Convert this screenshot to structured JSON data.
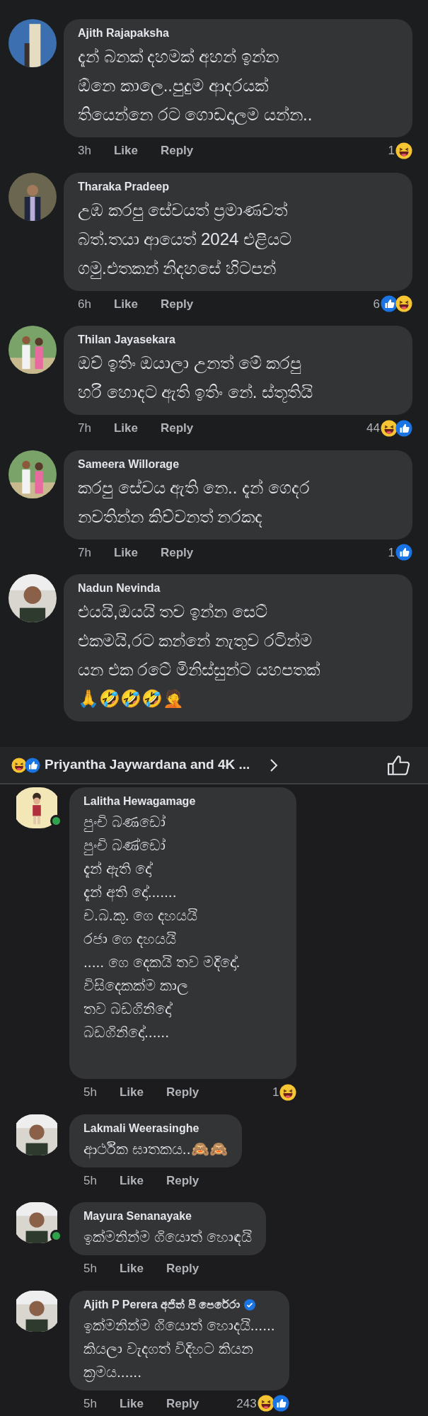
{
  "sections": [
    {
      "kind": "wide",
      "comments": [
        {
          "author": "Ajith Rajapaksha",
          "online": false,
          "verified": false,
          "text": "දැන් බනක් දහමක් අහන් ඉන්න\nඕනෙ කාලෙ..පුදුම ආදරයක්\nතියෙන්නෙ රට ගොඩදාලම යන්න..",
          "time": "3h",
          "like": "Like",
          "reply": "Reply",
          "count": "1",
          "reactions": [
            {
              "kind": "haha"
            }
          ]
        },
        {
          "author": "Tharaka Pradeep",
          "online": false,
          "verified": false,
          "text": "උඹ කරපු සේවයත් ප්‍රමාණවත්\nබත්.තයා ආයෙත් 2024 එළියට\nගමු.එතකන් නිදහසේ හිටපන්",
          "time": "6h",
          "like": "Like",
          "reply": "Reply",
          "count": "6",
          "reactions": [
            {
              "kind": "like"
            },
            {
              "kind": "haha"
            }
          ]
        },
        {
          "author": "Thilan Jayasekara",
          "online": false,
          "verified": false,
          "text": "ඔව් ඉතිං ඔයාලා උනත් මේ කරපු\nහරි හොදට ඇති ඉතිං නේ. ස්තූතියි",
          "time": "7h",
          "like": "Like",
          "reply": "Reply",
          "count": "44",
          "reactions": [
            {
              "kind": "haha"
            },
            {
              "kind": "like"
            }
          ]
        },
        {
          "author": "Sameera Willorage",
          "online": false,
          "verified": false,
          "text": "කරපු සේවය ඇති නෙ.. දැන් ගෙදර\nනවතින්න කිව්වනත් නරකද",
          "time": "7h",
          "like": "Like",
          "reply": "Reply",
          "count": "1",
          "reactions": [
            {
              "kind": "like"
            }
          ]
        },
        {
          "author": "Nadun Nevinda",
          "online": false,
          "verified": false,
          "text": "එයයි,ඔයයි තව ඉන්න සෙට්\nඑකමයි,රට කන්නේ නැතුව රටින්ම\nයන එක රටේ මිනිස්සුන්ට යහපතක්\n🙏🤣🤣🤣🤦"
        }
      ]
    },
    {
      "kind": "summary",
      "reactions": [
        {
          "kind": "haha"
        },
        {
          "kind": "like"
        }
      ],
      "text": "Priyantha Jaywardana and 4K ..."
    },
    {
      "kind": "fit",
      "comments": [
        {
          "author": "Lalitha Hewagamage",
          "online": true,
          "verified": false,
          "text": "පුංචි බණඩෝ\nපුංචි බණ්ඩෝ\nදැන් ඇති දෝ\nදැන් අති දෝ.......\nච.බ.කු. ගෙ දහයයි\nරජා ගෙ දහයයි\n..... ගෙ දෙකයි තව මදිදෝ.\nවිසිදෙකක්ම කාල\nතව බඩගිනිදෝ\nබඩගිනිදෝ......",
          "time": "5h",
          "like": "Like",
          "reply": "Reply",
          "count": "1",
          "reactions": [
            {
              "kind": "haha"
            }
          ]
        },
        {
          "author": "Lakmali Weerasinghe",
          "online": false,
          "verified": false,
          "text": "ආර්ථික ඝාතකය..🙈🙈",
          "time": "5h",
          "like": "Like",
          "reply": "Reply"
        },
        {
          "author": "Mayura Senanayake",
          "online": true,
          "verified": false,
          "text": "ඉක්මනින්ම ගියොත් හොඳයි",
          "time": "5h",
          "like": "Like",
          "reply": "Reply"
        },
        {
          "author": "Ajith P Perera අජිත් පී පෙරේරා",
          "online": false,
          "verified": true,
          "text": "ඉක්මනින්ම ගියොත් හොදයි......\nකියලා වැදගත් විදිහට කියන\nක්‍රමය......",
          "time": "5h",
          "like": "Like",
          "reply": "Reply",
          "count": "243",
          "reactions": [
            {
              "kind": "haha"
            },
            {
              "kind": "like"
            }
          ]
        }
      ]
    }
  ]
}
